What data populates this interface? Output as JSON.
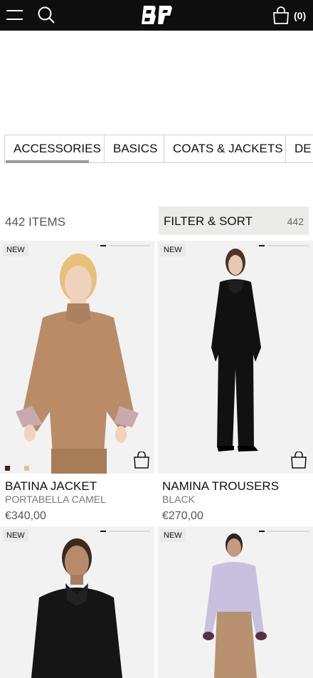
{
  "header": {
    "brand": "BP",
    "bag_count": "(0)",
    "icons": [
      "menu-icon",
      "search-icon",
      "bag-icon"
    ]
  },
  "categories": [
    "ACCESSORIES",
    "BASICS",
    "COATS & JACKETS",
    "DE"
  ],
  "listing": {
    "items_count": "442 ITEMS",
    "filter_label": "FILTER & SORT",
    "filter_count": "442"
  },
  "products": [
    {
      "badge": "NEW",
      "name": "BATINA JACKET",
      "color": "PORTABELLA CAMEL",
      "price": "€340,00",
      "swatches": [
        "#4a1f14",
        "#f4f1e8",
        "#d6c88a"
      ]
    },
    {
      "badge": "NEW",
      "name": "NAMINA TROUSERS",
      "color": "BLACK",
      "price": "€270,00",
      "swatches": []
    },
    {
      "badge": "NEW",
      "name": "",
      "color": "",
      "price": "",
      "swatches": []
    },
    {
      "badge": "NEW",
      "name": "",
      "color": "",
      "price": "",
      "swatches": []
    }
  ],
  "colors": {
    "topbar": "#0e0e0e",
    "image_bg": "#f2f2f2",
    "filter_bg": "#ebebe9"
  }
}
